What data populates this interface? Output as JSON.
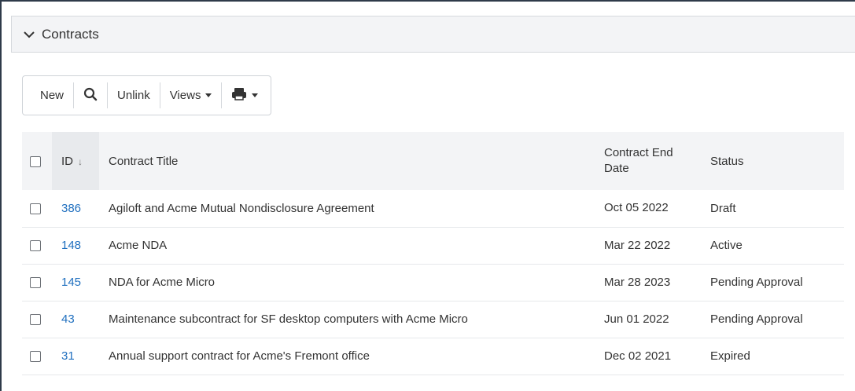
{
  "panel": {
    "title": "Contracts"
  },
  "toolbar": {
    "new_label": "New",
    "search_icon": "search-icon",
    "unlink_label": "Unlink",
    "views_label": "Views",
    "print_icon": "printer-icon"
  },
  "table": {
    "headers": {
      "id": "ID",
      "title": "Contract Title",
      "end_date_line1": "Contract End",
      "end_date_line2": "Date",
      "status": "Status"
    },
    "sort": {
      "column": "ID",
      "direction": "descending"
    },
    "rows": [
      {
        "id": "386",
        "title": "Agiloft and Acme Mutual Nondisclosure Agreement",
        "end_date": "Oct 05 2022",
        "status": "Draft"
      },
      {
        "id": "148",
        "title": "Acme NDA",
        "end_date": "Mar 22 2022",
        "status": "Active"
      },
      {
        "id": "145",
        "title": "NDA for Acme Micro",
        "end_date": "Mar 28 2023",
        "status": "Pending Approval"
      },
      {
        "id": "43",
        "title": "Maintenance subcontract for SF desktop computers with Acme Micro",
        "end_date": "Jun 01 2022",
        "status": "Pending Approval"
      },
      {
        "id": "31",
        "title": "Annual support contract for Acme's Fremont office",
        "end_date": "Dec 02 2021",
        "status": "Expired"
      }
    ]
  },
  "colors": {
    "link": "#1f6fbf",
    "header_bg": "#f3f4f6",
    "frame_border": "#2f3b4a"
  }
}
